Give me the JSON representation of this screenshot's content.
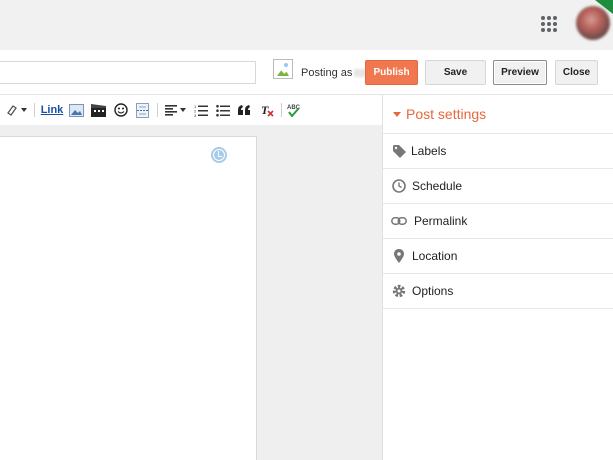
{
  "header": {
    "apps_icon": "apps-grid-icon",
    "avatar_icon": "user-avatar"
  },
  "editor_bar": {
    "posting_as_label": "Posting as",
    "buttons": {
      "publish": "Publish",
      "save": "Save",
      "preview": "Preview",
      "close": "Close"
    },
    "colors": {
      "publish_bg": "#f0774e",
      "accent": "#e8673d"
    }
  },
  "toolbar": {
    "link_label": "Link",
    "tools": [
      "highlight-icon",
      "insert-image-icon",
      "insert-video-icon",
      "insert-emoji-icon",
      "jump-break-icon",
      "align-icon",
      "numbered-list-icon",
      "bullet-list-icon",
      "quote-icon",
      "remove-formatting-icon",
      "spell-check-icon"
    ]
  },
  "sidebar": {
    "title": "Post settings",
    "items": [
      {
        "label": "Labels",
        "icon": "tag-icon"
      },
      {
        "label": "Schedule",
        "icon": "clock-icon"
      },
      {
        "label": "Permalink",
        "icon": "link-icon"
      },
      {
        "label": "Location",
        "icon": "location-pin-icon"
      },
      {
        "label": "Options",
        "icon": "gear-icon"
      }
    ]
  }
}
